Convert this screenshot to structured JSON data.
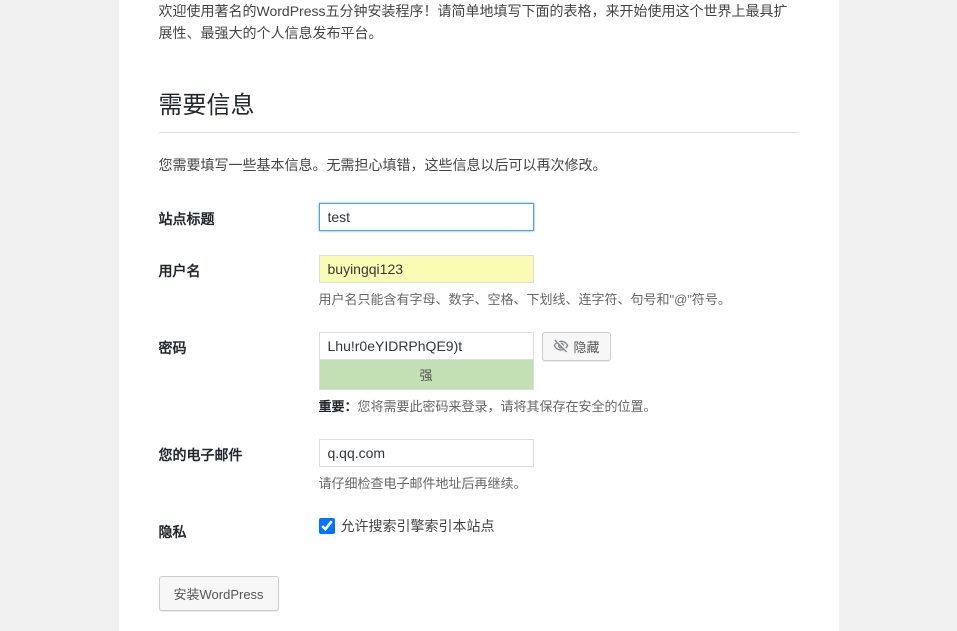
{
  "intro": "欢迎使用著名的WordPress五分钟安装程序！请简单地填写下面的表格，来开始使用这个世界上最具扩展性、最强大的个人信息发布平台。",
  "heading": "需要信息",
  "subtext": "您需要填写一些基本信息。无需担心填错，这些信息以后可以再次修改。",
  "site_title": {
    "label": "站点标题",
    "value": "test"
  },
  "username": {
    "label": "用户名",
    "value": "buyingqi123",
    "hint": "用户名只能含有字母、数字、空格、下划线、连字符、句号和\"@\"符号。"
  },
  "password": {
    "label": "密码",
    "value": "Lhu!r0eYIDRPhQE9)t",
    "strength": "强",
    "hide_label": "隐藏",
    "hint_prefix": "重要：",
    "hint": "您将需要此密码来登录，请将其保存在安全的位置。"
  },
  "email": {
    "label": "您的电子邮件",
    "value": "q.qq.com",
    "hint": "请仔细检查电子邮件地址后再继续。"
  },
  "privacy": {
    "label": "隐私",
    "checkbox_label": "允许搜索引擎索引本站点"
  },
  "install_button": "安装WordPress"
}
